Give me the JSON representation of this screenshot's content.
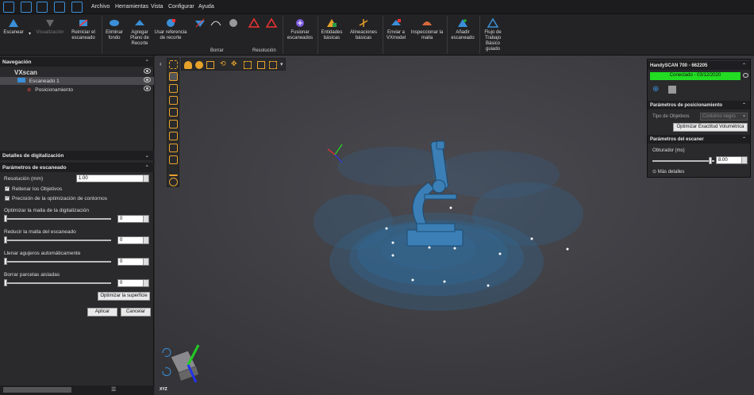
{
  "menu": {
    "items": [
      "Archivo",
      "Herramientas",
      "Vista",
      "Configurar",
      "Ayuda"
    ]
  },
  "ribbon": {
    "scan": "Escanear",
    "visualization": "Visualización",
    "reset_scan": "Reiniciar el escaneado",
    "remove_background": "Eliminar fondo",
    "add_clip_plane": "Agregar Plano de Recorte",
    "use_clip_ref": "Usar referencia de recorte",
    "group_delete": "Borrar",
    "group_resolution": "Resolución",
    "merge_scans": "Fusionar escaneados",
    "basic_entities": "Entidades básicas",
    "basic_alignments": "Alineaciones básicas",
    "send_vxmodel": "Enviar a VXmodel",
    "inspect_mesh": "Inspeccionar la malla",
    "add_scan": "Añadir escaneado",
    "workflow": "Flujo de Trabajo Básico guiado"
  },
  "navigation": {
    "title": "Navegación",
    "root": "VXscan",
    "scan1": "Escaneado 1",
    "positioning": "Posicionamiento"
  },
  "details": {
    "title": "Detalles de digitalización"
  },
  "scan_params": {
    "title": "Parámetros de escaneado",
    "resolution_label": "Resolución (mm)",
    "resolution_value": "1.00",
    "fill_targets": "Rellenar los Objetivos",
    "contour_precision": "Precisión de la optimización de contornos",
    "optimize_mesh_label": "Optimizar la malla de la digitalización",
    "optimize_mesh_value": "0",
    "reduce_mesh_label": "Reducir la malla del escaneado",
    "reduce_mesh_value": "0",
    "fill_holes_label": "Llenar agujeros automáticamente",
    "fill_holes_value": "0",
    "remove_patches_label": "Borrar parcelas aisladas",
    "remove_patches_value": "0",
    "optimize_surface": "Optimizar la superficie",
    "apply": "Aplicar",
    "cancel": "Cancelar"
  },
  "scanner_panel": {
    "title": "HandySCAN 700 - 662205",
    "status": "Conectado - 03/12/2020",
    "status_color": "#22dd22",
    "positioning_title": "Parámetros de posicionamiento",
    "target_type_label": "Tipo de Objetivos",
    "target_type_value": "Contorno negro",
    "optimize_volumetric": "Optimizar Exactitud Volumétrica",
    "scanner_params_title": "Parámetros del escaner",
    "shutter_label": "Obturador (ms)",
    "shutter_value": "8.00",
    "more_details": "Más detalles"
  },
  "axis_label": "XYZ",
  "colors": {
    "accent": "#3a8fd8",
    "tool_orange": "#e7a22a",
    "scan_blue": "#2f6d9e"
  }
}
